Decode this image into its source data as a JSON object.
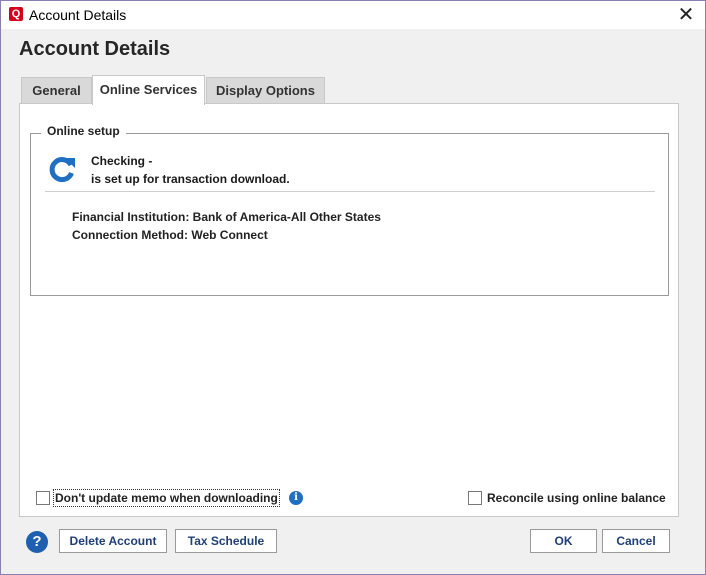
{
  "window": {
    "title": "Account Details",
    "app_icon_letter": "Q",
    "close_glyph": "✕"
  },
  "heading": "Account Details",
  "tabs": [
    {
      "label": "General",
      "active": false
    },
    {
      "label": "Online Services",
      "active": true
    },
    {
      "label": "Display Options",
      "active": false
    }
  ],
  "online_setup": {
    "legend": "Online setup",
    "status_icon": "refresh-icon",
    "account_line": "Checking -",
    "status_line": "is set up for transaction download.",
    "financial_institution_label": "Financial Institution:",
    "financial_institution_value": "Bank of America-All Other States",
    "connection_method_label": "Connection Method:",
    "connection_method_value": "Web Connect"
  },
  "options": {
    "dont_update_memo": {
      "label": "Don't update memo when downloading",
      "checked": false
    },
    "reconcile_online": {
      "label": "Reconcile using online balance",
      "checked": false
    },
    "info_glyph": "i"
  },
  "footer": {
    "help_glyph": "?",
    "delete_account": "Delete Account",
    "tax_schedule": "Tax Schedule",
    "ok": "OK",
    "cancel": "Cancel"
  },
  "colors": {
    "brand_red": "#d6001c",
    "accent_blue": "#1f6fc4",
    "link_text": "#1f3f7a"
  }
}
